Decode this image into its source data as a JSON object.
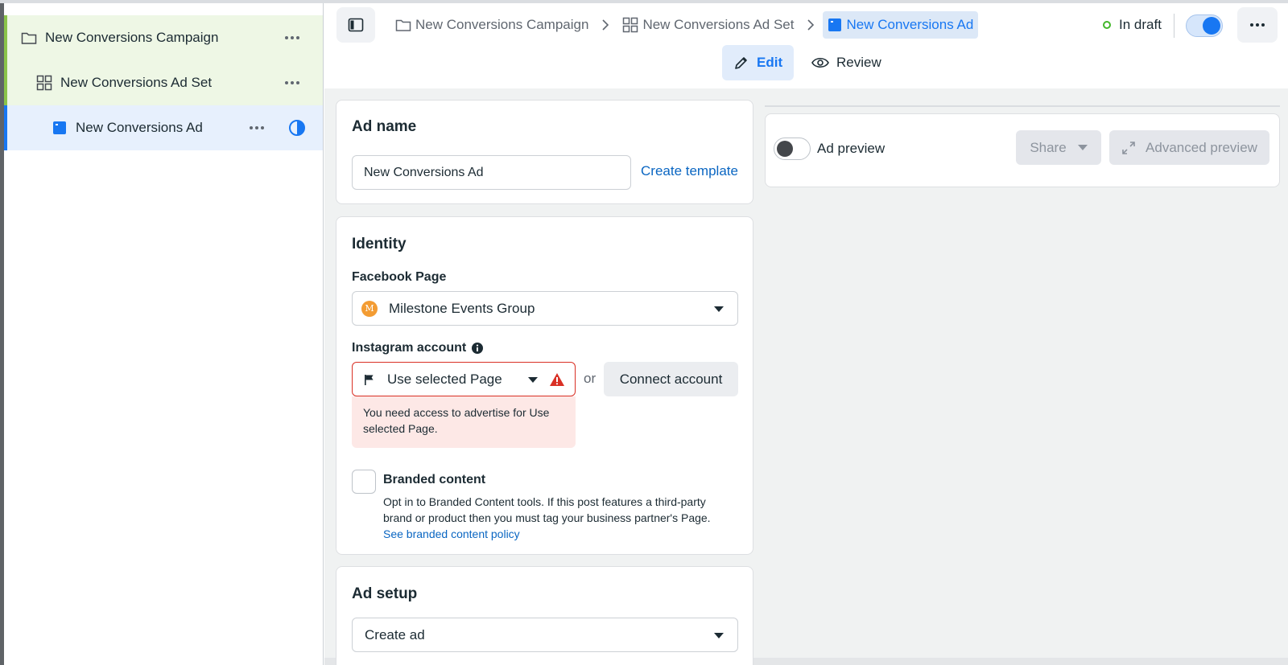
{
  "sidebar": {
    "items": [
      {
        "label": "New Conversions Campaign",
        "icon": "folder-icon"
      },
      {
        "label": "New Conversions Ad Set",
        "icon": "grid-icon"
      },
      {
        "label": "New Conversions Ad",
        "icon": "ad-icon"
      }
    ]
  },
  "header": {
    "breadcrumbs": [
      {
        "label": "New Conversions Campaign",
        "icon": "folder-icon"
      },
      {
        "label": "New Conversions Ad Set",
        "icon": "grid-icon"
      },
      {
        "label": "New Conversions Ad",
        "icon": "ad-icon"
      }
    ],
    "status": "In draft",
    "tabs": {
      "edit": "Edit",
      "review": "Review"
    }
  },
  "ad_name": {
    "title": "Ad name",
    "value": "New Conversions Ad",
    "template_link": "Create template"
  },
  "identity": {
    "title": "Identity",
    "facebook_page_label": "Facebook Page",
    "facebook_page_value": "Milestone Events Group",
    "facebook_page_avatar": "M",
    "instagram_label": "Instagram account",
    "instagram_value": "Use selected Page",
    "or_text": "or",
    "connect_button": "Connect account",
    "error_text": "You need access to advertise for Use selected Page.",
    "branded_title": "Branded content",
    "branded_desc_1": "Opt in to Branded Content tools. If this post features a third-party",
    "branded_desc_2": "brand or product then you must tag your business partner's Page.",
    "branded_link": "See branded content policy"
  },
  "ad_setup": {
    "title": "Ad setup",
    "value": "Create ad"
  },
  "preview": {
    "label": "Ad preview",
    "share_button": "Share",
    "advanced_button": "Advanced preview"
  },
  "colors": {
    "accent": "#1877f2",
    "error": "#d93025",
    "campaign_highlight": "#eef7e5",
    "selected_row": "#e7f0fd"
  }
}
